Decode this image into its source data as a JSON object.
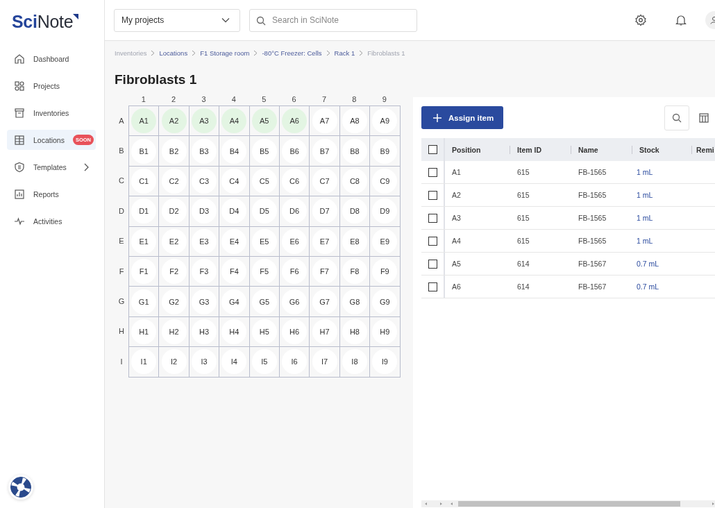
{
  "logo": {
    "bold": "Sci",
    "rest": "Note"
  },
  "sidebar": {
    "items": [
      {
        "label": "Dashboard",
        "selected": false,
        "expandable": false
      },
      {
        "label": "Projects",
        "selected": false,
        "expandable": false
      },
      {
        "label": "Inventories",
        "selected": false,
        "expandable": false
      },
      {
        "label": "Locations",
        "selected": true,
        "expandable": false,
        "badge": "SOON"
      },
      {
        "label": "Templates",
        "selected": false,
        "expandable": true
      },
      {
        "label": "Reports",
        "selected": false,
        "expandable": false
      },
      {
        "label": "Activities",
        "selected": false,
        "expandable": false
      }
    ]
  },
  "topbar": {
    "project_select": "My projects",
    "search": {
      "placeholder": "Search in SciNote"
    }
  },
  "breadcrumb": [
    {
      "label": "Inventories",
      "muted": true
    },
    {
      "label": "Locations",
      "muted": false
    },
    {
      "label": "F1 Storage room",
      "muted": false
    },
    {
      "label": "-80°C Freezer: Cells",
      "muted": false
    },
    {
      "label": "Rack 1",
      "muted": false
    },
    {
      "label": "Fibroblasts 1",
      "muted": true
    }
  ],
  "title": "Fibroblasts 1",
  "grid": {
    "columns": [
      "1",
      "2",
      "3",
      "4",
      "5",
      "6",
      "7",
      "8",
      "9"
    ],
    "rows": [
      {
        "label": "A",
        "cells": [
          {
            "label": "A1",
            "occupied": true
          },
          {
            "label": "A2",
            "occupied": true
          },
          {
            "label": "A3",
            "occupied": true
          },
          {
            "label": "A4",
            "occupied": true
          },
          {
            "label": "A5",
            "occupied": true
          },
          {
            "label": "A6",
            "occupied": true
          },
          {
            "label": "A7",
            "occupied": false
          },
          {
            "label": "A8",
            "occupied": false
          },
          {
            "label": "A9",
            "occupied": false
          }
        ]
      },
      {
        "label": "B",
        "cells": [
          {
            "label": "B1",
            "occupied": false
          },
          {
            "label": "B2",
            "occupied": false
          },
          {
            "label": "B3",
            "occupied": false
          },
          {
            "label": "B4",
            "occupied": false
          },
          {
            "label": "B5",
            "occupied": false
          },
          {
            "label": "B6",
            "occupied": false
          },
          {
            "label": "B7",
            "occupied": false
          },
          {
            "label": "B8",
            "occupied": false
          },
          {
            "label": "B9",
            "occupied": false
          }
        ]
      },
      {
        "label": "C",
        "cells": [
          {
            "label": "C1",
            "occupied": false
          },
          {
            "label": "C2",
            "occupied": false
          },
          {
            "label": "C3",
            "occupied": false
          },
          {
            "label": "C4",
            "occupied": false
          },
          {
            "label": "C5",
            "occupied": false
          },
          {
            "label": "C6",
            "occupied": false
          },
          {
            "label": "C7",
            "occupied": false
          },
          {
            "label": "C8",
            "occupied": false
          },
          {
            "label": "C9",
            "occupied": false
          }
        ]
      },
      {
        "label": "D",
        "cells": [
          {
            "label": "D1",
            "occupied": false
          },
          {
            "label": "D2",
            "occupied": false
          },
          {
            "label": "D3",
            "occupied": false
          },
          {
            "label": "D4",
            "occupied": false
          },
          {
            "label": "D5",
            "occupied": false
          },
          {
            "label": "D6",
            "occupied": false
          },
          {
            "label": "D7",
            "occupied": false
          },
          {
            "label": "D8",
            "occupied": false
          },
          {
            "label": "D9",
            "occupied": false
          }
        ]
      },
      {
        "label": "E",
        "cells": [
          {
            "label": "E1",
            "occupied": false
          },
          {
            "label": "E2",
            "occupied": false
          },
          {
            "label": "E3",
            "occupied": false
          },
          {
            "label": "E4",
            "occupied": false
          },
          {
            "label": "E5",
            "occupied": false
          },
          {
            "label": "E6",
            "occupied": false
          },
          {
            "label": "E7",
            "occupied": false
          },
          {
            "label": "E8",
            "occupied": false
          },
          {
            "label": "E9",
            "occupied": false
          }
        ]
      },
      {
        "label": "F",
        "cells": [
          {
            "label": "F1",
            "occupied": false
          },
          {
            "label": "F2",
            "occupied": false
          },
          {
            "label": "F3",
            "occupied": false
          },
          {
            "label": "F4",
            "occupied": false
          },
          {
            "label": "F5",
            "occupied": false
          },
          {
            "label": "F6",
            "occupied": false
          },
          {
            "label": "F7",
            "occupied": false
          },
          {
            "label": "F8",
            "occupied": false
          },
          {
            "label": "F9",
            "occupied": false
          }
        ]
      },
      {
        "label": "G",
        "cells": [
          {
            "label": "G1",
            "occupied": false
          },
          {
            "label": "G2",
            "occupied": false
          },
          {
            "label": "G3",
            "occupied": false
          },
          {
            "label": "G4",
            "occupied": false
          },
          {
            "label": "G5",
            "occupied": false
          },
          {
            "label": "G6",
            "occupied": false
          },
          {
            "label": "G7",
            "occupied": false
          },
          {
            "label": "G8",
            "occupied": false
          },
          {
            "label": "G9",
            "occupied": false
          }
        ]
      },
      {
        "label": "H",
        "cells": [
          {
            "label": "H1",
            "occupied": false
          },
          {
            "label": "H2",
            "occupied": false
          },
          {
            "label": "H3",
            "occupied": false
          },
          {
            "label": "H4",
            "occupied": false
          },
          {
            "label": "H5",
            "occupied": false
          },
          {
            "label": "H6",
            "occupied": false
          },
          {
            "label": "H7",
            "occupied": false
          },
          {
            "label": "H8",
            "occupied": false
          },
          {
            "label": "H9",
            "occupied": false
          }
        ]
      },
      {
        "label": "I",
        "cells": [
          {
            "label": "I1",
            "occupied": false
          },
          {
            "label": "I2",
            "occupied": false
          },
          {
            "label": "I3",
            "occupied": false
          },
          {
            "label": "I4",
            "occupied": false
          },
          {
            "label": "I5",
            "occupied": false
          },
          {
            "label": "I6",
            "occupied": false
          },
          {
            "label": "I7",
            "occupied": false
          },
          {
            "label": "I8",
            "occupied": false
          },
          {
            "label": "I9",
            "occupied": false
          }
        ]
      }
    ]
  },
  "assign_button": "Assign item",
  "table": {
    "all_checked": false,
    "columns": [
      "Position",
      "Item ID",
      "Name",
      "Stock",
      "Remi"
    ],
    "rows": [
      {
        "checked": false,
        "cells": [
          "A1",
          "615",
          "FB-1565",
          "1 mL"
        ]
      },
      {
        "checked": false,
        "cells": [
          "A2",
          "615",
          "FB-1565",
          "1 mL"
        ]
      },
      {
        "checked": false,
        "cells": [
          "A3",
          "615",
          "FB-1565",
          "1 mL"
        ]
      },
      {
        "checked": false,
        "cells": [
          "A4",
          "615",
          "FB-1565",
          "1 mL"
        ]
      },
      {
        "checked": false,
        "cells": [
          "A5",
          "614",
          "FB-1567",
          "0.7 mL"
        ]
      },
      {
        "checked": false,
        "cells": [
          "A6",
          "614",
          "FB-1567",
          "0.7 mL"
        ]
      }
    ]
  }
}
